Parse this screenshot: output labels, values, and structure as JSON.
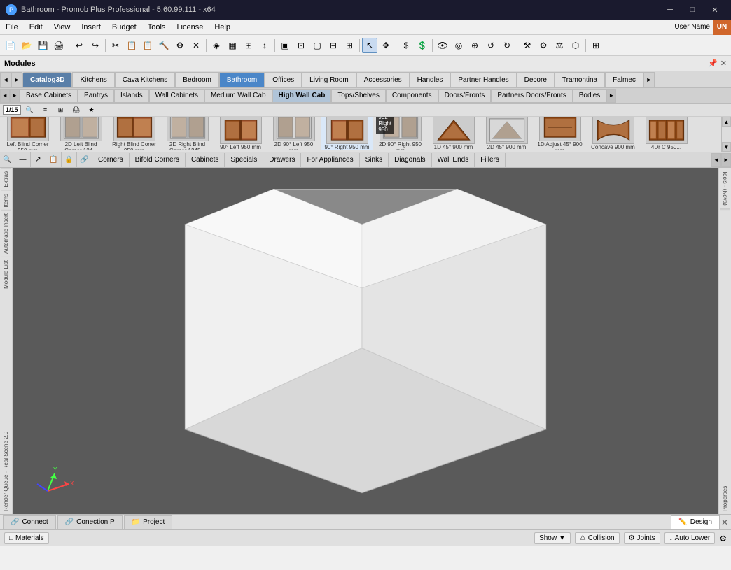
{
  "titleBar": {
    "icon": "P",
    "title": "Bathroom - Promob Plus Professional - 5.60.99.111 - x64",
    "minimize": "─",
    "maximize": "□",
    "close": "✕"
  },
  "menuBar": {
    "items": [
      "File",
      "Edit",
      "View",
      "Insert",
      "Budget",
      "Tools",
      "License",
      "Help"
    ]
  },
  "userArea": {
    "label": "User Name",
    "initials": "UN"
  },
  "catalogTabs": {
    "navLeft": "◄",
    "navRight": "►",
    "items": [
      {
        "id": "catalog3d",
        "label": "Catalog3D",
        "active": true,
        "special": true
      },
      {
        "id": "kitchens",
        "label": "Kitchens",
        "active": false
      },
      {
        "id": "cava",
        "label": "Cava Kitchens",
        "active": false
      },
      {
        "id": "bedroom",
        "label": "Bedroom",
        "active": false
      },
      {
        "id": "bathroom",
        "label": "Bathroom",
        "active": false
      },
      {
        "id": "offices",
        "label": "Offices",
        "active": false
      },
      {
        "id": "living",
        "label": "Living Room",
        "active": false
      },
      {
        "id": "accessories",
        "label": "Accessories",
        "active": false
      },
      {
        "id": "handles",
        "label": "Handles",
        "active": false
      },
      {
        "id": "partner",
        "label": "Partner Handles",
        "active": false
      },
      {
        "id": "decore",
        "label": "Decore",
        "active": false
      },
      {
        "id": "tramontina",
        "label": "Tramontina",
        "active": false
      },
      {
        "id": "falmec",
        "label": "Falmec",
        "active": false
      }
    ],
    "more": "►"
  },
  "subTabs": {
    "navLeft": "◄",
    "navRight": "►",
    "items": [
      {
        "id": "base",
        "label": "Base Cabinets",
        "active": false
      },
      {
        "id": "pantrys",
        "label": "Pantrys",
        "active": false
      },
      {
        "id": "islands",
        "label": "Islands",
        "active": false
      },
      {
        "id": "wall",
        "label": "Wall Cabinets",
        "active": false
      },
      {
        "id": "medwall",
        "label": "Medium Wall Cab",
        "active": false
      },
      {
        "id": "highwall",
        "label": "High Wall Cab",
        "active": true
      },
      {
        "id": "tops",
        "label": "Tops/Shelves",
        "active": false
      },
      {
        "id": "components",
        "label": "Components",
        "active": false
      },
      {
        "id": "doors",
        "label": "Doors/Fronts",
        "active": false
      },
      {
        "id": "partners",
        "label": "Partners Doors/Fronts",
        "active": false
      },
      {
        "id": "bodies",
        "label": "Bodies",
        "active": false
      }
    ],
    "more": "►"
  },
  "pagination": {
    "current": "1/15"
  },
  "moduleItems": [
    {
      "id": "leftblind",
      "label": "Left Blind Corner 950 mm",
      "color": "#8B4513"
    },
    {
      "id": "2dleftblind",
      "label": "2D Left Blind Corner 124...",
      "color": "#8B4513"
    },
    {
      "id": "rightblind",
      "label": "Right Blind Coner 950 mm",
      "color": "#8B4513"
    },
    {
      "id": "2drightblind",
      "label": "2D Right Blind Corner 1245...",
      "color": "#8B4513"
    },
    {
      "id": "90left",
      "label": "90° Left 950 mm",
      "color": "#8B4513"
    },
    {
      "id": "2d90left",
      "label": "2D 90° Left 950 mm",
      "color": "#8B4513"
    },
    {
      "id": "90right",
      "label": "90° Right 950 mm",
      "color": "#8B4513"
    },
    {
      "id": "2d90right",
      "label": "2D 90° Right 950 mm",
      "color": "#8B4513"
    },
    {
      "id": "1d45",
      "label": "1D 45° 900 mm",
      "color": "#8B4513"
    },
    {
      "id": "2d45",
      "label": "2D 45° 900 mm",
      "color": "#8B4513"
    },
    {
      "id": "1dadjust",
      "label": "1D Adjust 45° 900 mm",
      "color": "#8B4513"
    },
    {
      "id": "concave",
      "label": "Concave 900 mm",
      "color": "#8B4513"
    },
    {
      "id": "4drcorner",
      "label": "4Dr C 950...",
      "color": "#8B4513"
    }
  ],
  "filterTabs": {
    "icons": [
      "🔍",
      "—",
      "↗",
      "📋",
      "🔒",
      "🔗"
    ],
    "items": [
      {
        "id": "corners",
        "label": "Corners",
        "active": false
      },
      {
        "id": "bifold",
        "label": "Bifold Corners",
        "active": false
      },
      {
        "id": "cabinets",
        "label": "Cabinets",
        "active": false
      },
      {
        "id": "specials",
        "label": "Specials",
        "active": false
      },
      {
        "id": "drawers",
        "label": "Drawers",
        "active": false
      },
      {
        "id": "appliances",
        "label": "For Appliances",
        "active": false
      },
      {
        "id": "sinks",
        "label": "Sinks",
        "active": false
      },
      {
        "id": "diagonals",
        "label": "Diagonals",
        "active": false
      },
      {
        "id": "wallends",
        "label": "Wall Ends",
        "active": false
      },
      {
        "id": "fillers",
        "label": "Fillers",
        "active": false
      }
    ],
    "moreLeft": "◄",
    "moreRight": "►"
  },
  "modulesHeader": {
    "title": "Modules",
    "pin": "📌",
    "close": "✕"
  },
  "leftSidebar": {
    "items": [
      "Extras",
      "Items",
      "Automatic Insert",
      "Module List",
      "Render Queue - Real Scene 2.0"
    ]
  },
  "rightSidebar": {
    "items": [
      "Tools - (Nova)",
      "Properties"
    ]
  },
  "bottomTabs": {
    "items": [
      {
        "id": "connect",
        "label": "Connect",
        "icon": "🔗",
        "active": false
      },
      {
        "id": "conectionp",
        "label": "Conection P",
        "icon": "🔗",
        "active": false
      },
      {
        "id": "project",
        "label": "Project",
        "icon": "📁",
        "active": false
      },
      {
        "id": "design",
        "label": "Design",
        "icon": "✏️",
        "active": true
      }
    ],
    "close": "✕"
  },
  "statusBar": {
    "items": [
      {
        "id": "materials",
        "label": "Materials",
        "icon": "□"
      }
    ],
    "rightItems": [
      {
        "id": "show",
        "label": "Show ▼"
      },
      {
        "id": "collision",
        "label": "Collision"
      },
      {
        "id": "joints",
        "label": "Joints"
      },
      {
        "id": "autolower",
        "label": "Auto Lower"
      }
    ]
  },
  "viewport": {
    "bgColor": "#5a5a5a"
  },
  "detectedText": {
    "coord1": "902",
    "coord2": "Right",
    "coord3": "950"
  }
}
